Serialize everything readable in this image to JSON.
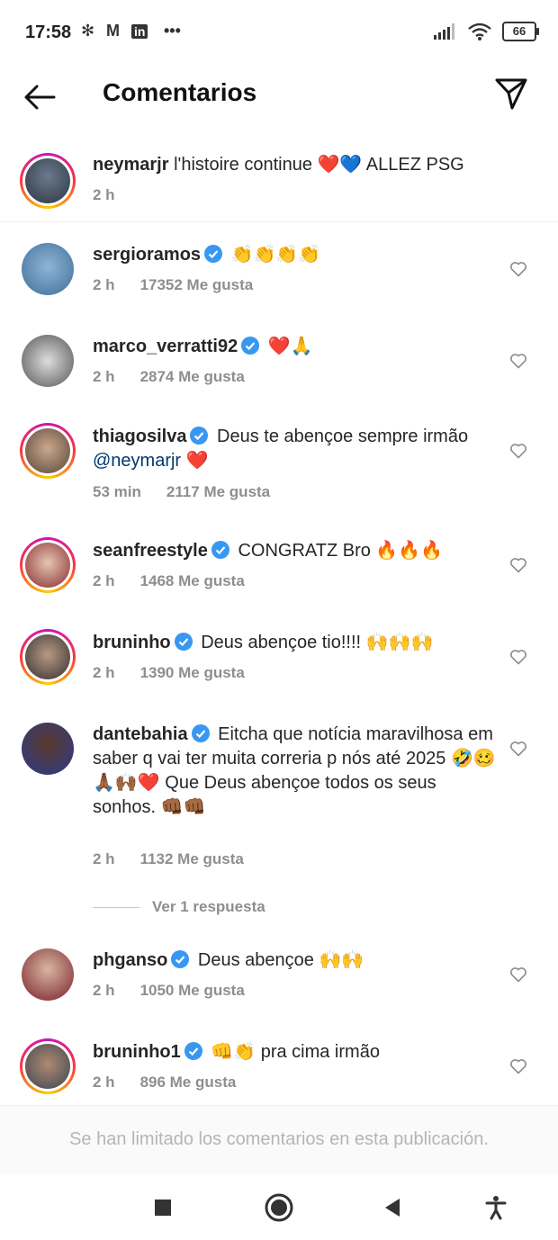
{
  "status_bar": {
    "time": "17:58",
    "battery": "66",
    "notif_icons": [
      "bug-icon",
      "gmail-icon",
      "linkedin-icon",
      "more-dots-icon"
    ]
  },
  "header": {
    "title": "Comentarios"
  },
  "caption": {
    "username": "neymarjr",
    "text": "l'histoire continue ❤️💙 ALLEZ PSG",
    "time": "2 h"
  },
  "comments": [
    {
      "username": "sergioramos",
      "verified": true,
      "text": "👏👏👏👏",
      "time": "2 h",
      "likes": "17352 Me gusta"
    },
    {
      "username": "marco_verratti92",
      "verified": true,
      "text": "❤️🙏",
      "time": "2 h",
      "likes": "2874 Me gusta"
    },
    {
      "username": "thiagosilva",
      "verified": true,
      "text": "Deus te abençoe sempre",
      "text2": "irmão",
      "mention": "@neymarjr",
      "text3": "❤️",
      "time": "53 min",
      "likes": "2117 Me gusta"
    },
    {
      "username": "seanfreestyle",
      "verified": true,
      "text": "CONGRATZ Bro 🔥🔥🔥",
      "time": "2 h",
      "likes": "1468 Me gusta"
    },
    {
      "username": "bruninho",
      "verified": true,
      "text": "Deus abençoe tio!!!! 🙌🙌🙌",
      "time": "2 h",
      "likes": "1390 Me gusta"
    },
    {
      "username": "dantebahia",
      "verified": true,
      "text": "Eitcha que notícia maravilhosa em saber q vai ter muita correria p nós até 2025 🤣🥴🙏🏾🙌🏾❤️ Que Deus abençoe todos os seus sonhos. 👊🏾👊🏾",
      "time": "2 h",
      "likes": "1132 Me gusta",
      "replies": "Ver 1 respuesta"
    },
    {
      "username": "phganso",
      "verified": true,
      "text": "Deus abençoe 🙌🙌",
      "time": "2 h",
      "likes": "1050 Me gusta"
    },
    {
      "username": "bruninho1",
      "verified": true,
      "text": "👊👏 pra cima irmão",
      "time": "2 h",
      "likes": "896 Me gusta"
    }
  ],
  "limited_notice": "Se han limitado los comentarios en esta publicación.",
  "colors": {
    "verified": "#3897f0",
    "mention": "#00376b",
    "meta": "#8e8e8e"
  }
}
